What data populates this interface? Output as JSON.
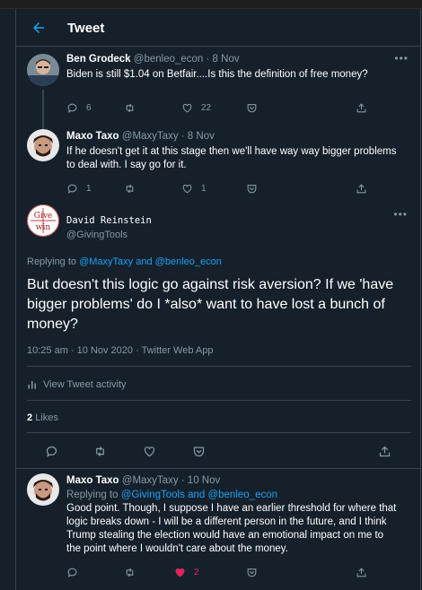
{
  "header": {
    "title": "Tweet"
  },
  "tweets": [
    {
      "name": "Ben Grodeck",
      "handle": "@benleo_econ",
      "time": "· 8 Nov",
      "text": "Biden is still $1.04 on Betfair....Is this the definition of free money?",
      "reply_count": "6",
      "like_count": "22"
    },
    {
      "name": "Maxo Taxo",
      "handle": "@MaxyTaxy",
      "time": "· 8 Nov",
      "text": "If he doesn't get it at this stage then we'll have way way bigger problems to deal with. I say go for it.",
      "reply_count": "1",
      "like_count": "1"
    }
  ],
  "main": {
    "name": "David Reinstein",
    "handle": "@GivingTools",
    "avatar_text_top": "Give",
    "avatar_text_bottom": "win",
    "replying_prefix": "Replying to",
    "replying_to_1": "@MaxyTaxy",
    "replying_and": "and",
    "replying_to_2": "@benleo_econ",
    "text": "But doesn't this logic go against risk aversion? If we 'have bigger problems' do I *also* want to have lost a bunch of money?",
    "timestamp": "10:25 am · 10 Nov 2020 · Twitter Web App",
    "activity_label": "View Tweet activity",
    "likes_count": "2",
    "likes_label": "Likes"
  },
  "reply": {
    "name": "Maxo Taxo",
    "handle": "@MaxyTaxy",
    "time": "· 10 Nov",
    "replying_prefix": "Replying to",
    "replying_to_1": "@GivingTools",
    "replying_and": "and",
    "replying_to_2": "@benleo_econ",
    "text": "Good point. Though, I suppose I have an earlier threshold for where that logic breaks down - I will be a different person in the future, and I think Trump stealing the election would have an emotional impact on me to the point where I wouldn't care about the money.",
    "like_count": "2"
  },
  "icons": {
    "back": "arrow-left-icon",
    "reply": "comment-icon",
    "retweet": "retweet-icon",
    "like": "heart-icon",
    "bookmark": "bookmark-icon",
    "share": "share-icon",
    "more": "more-icon",
    "activity": "bar-chart-icon"
  },
  "colors": {
    "background": "#15202b",
    "accent": "#1da1f2",
    "liked": "#e0245e",
    "muted": "#8899a6",
    "border": "#38444d"
  }
}
